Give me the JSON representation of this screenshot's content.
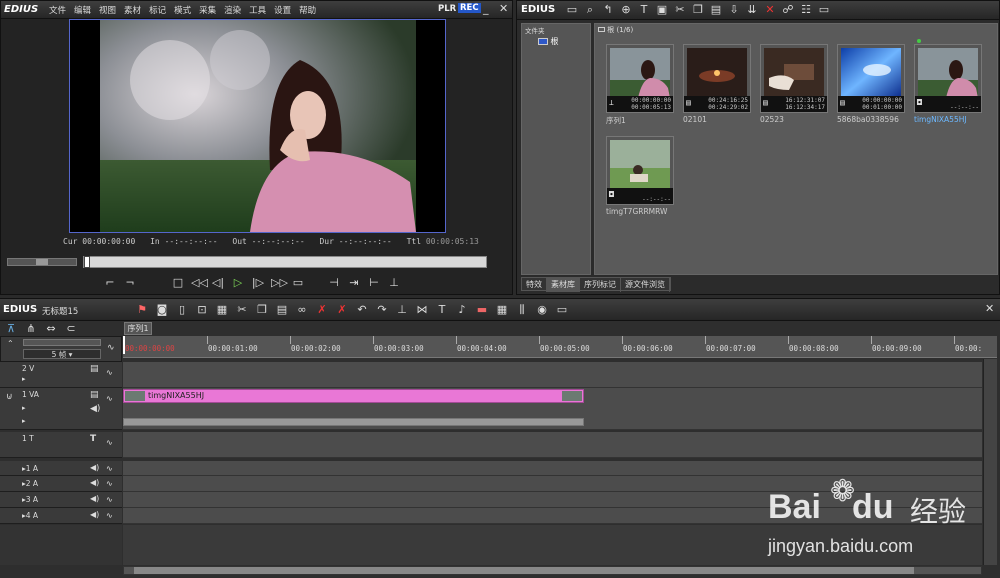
{
  "menu": {
    "logo": "EDIUS",
    "items": [
      "文件",
      "编辑",
      "视图",
      "素材",
      "标记",
      "模式",
      "采集",
      "渲染",
      "工具",
      "设置",
      "帮助"
    ],
    "plr": "PLR",
    "rec": "REC"
  },
  "player": {
    "cur_label": "Cur",
    "cur": "00:00:00:00",
    "in_label": "In",
    "in": "--:--:--:--",
    "out_label": "Out",
    "out": "--:--:--:--",
    "dur_label": "Dur",
    "dur": "--:--:--:--",
    "ttl_label": "Ttl",
    "ttl": "00:00:05:13"
  },
  "bin": {
    "logo": "EDIUS",
    "folder_header": "文件夹",
    "root": "根",
    "content_header": "根 (1/6)",
    "clips": [
      {
        "name": "序列1",
        "tc1": "00:00:00:00",
        "tc2": "00:00:05:13",
        "type": "seq"
      },
      {
        "name": "02101",
        "tc1": "00:24:16:25",
        "tc2": "00:24:29:02",
        "type": "video"
      },
      {
        "name": "02523",
        "tc1": "16:12:31:07",
        "tc2": "16:12:34:17",
        "type": "video"
      },
      {
        "name": "5868ba0338596",
        "tc1": "00:00:00:00",
        "tc2": "00:01:00:00",
        "type": "video"
      },
      {
        "name": "timgNIXA55HJ",
        "tc1": "",
        "tc2": "--:--:--",
        "type": "still"
      },
      {
        "name": "timgT7GRRMRW",
        "tc1": "",
        "tc2": "--:--:--",
        "type": "still"
      }
    ],
    "tabs": [
      "特效",
      "素材库",
      "序列标记",
      "源文件浏览"
    ]
  },
  "timeline": {
    "logo": "EDIUS",
    "project": "无标题15",
    "sequence_tab": "序列1",
    "zoom": "5 帧",
    "ruler": [
      "00:00:00:00",
      "00:00:01:00",
      "00:00:02:00",
      "00:00:03:00",
      "00:00:04:00",
      "00:00:05:00",
      "00:00:06:00",
      "00:00:07:00",
      "00:00:08:00",
      "00:00:09:00",
      "00:00:"
    ],
    "tracks": {
      "v2": "2 V",
      "va1": "1 VA",
      "t1": "1 T",
      "a1": "1 A",
      "a2": "2 A",
      "a3": "3 A",
      "a4": "4 A"
    },
    "clip_name": "timgNIXA55HJ"
  },
  "watermark": {
    "brand": "Bai",
    "brand2": "du",
    "cn": "经验",
    "url": "jingyan.baidu.com"
  }
}
